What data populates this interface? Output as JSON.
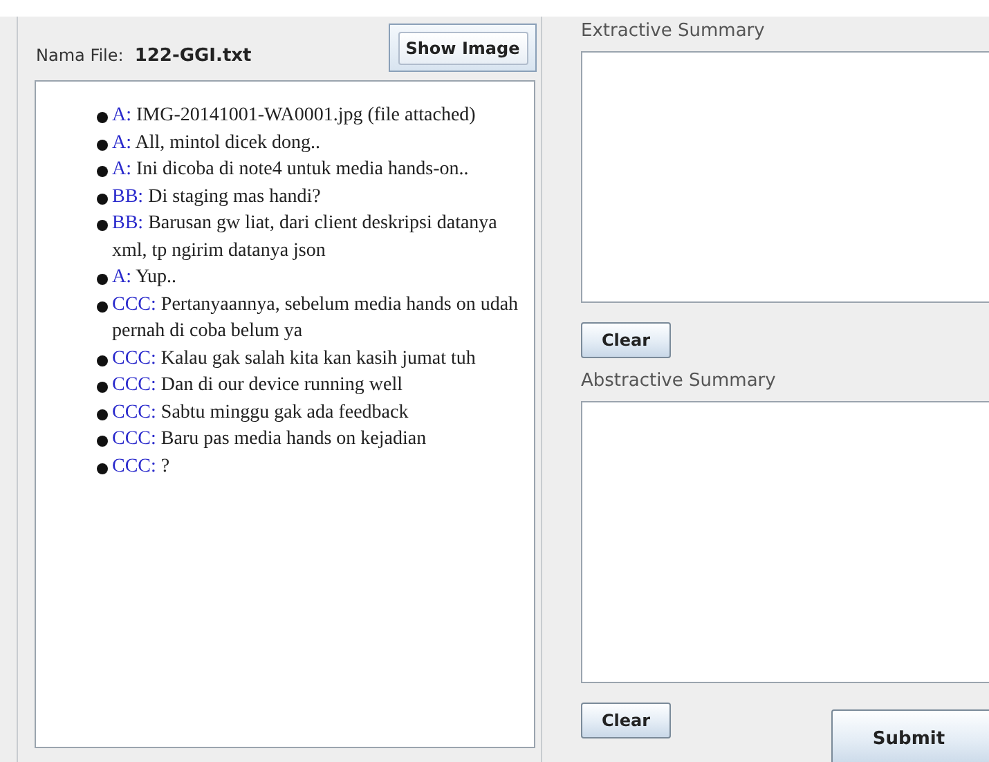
{
  "file_panel": {
    "label": "Nama File:",
    "file_name": "122-GGI.txt",
    "show_image_button": "Show Image"
  },
  "messages": [
    {
      "speaker": "A:",
      "text": " IMG-20141001-WA0001.jpg (file attached)"
    },
    {
      "speaker": "A:",
      "text": " All, mintol dicek dong.."
    },
    {
      "speaker": "A:",
      "text": " Ini dicoba di note4 untuk media hands-on.."
    },
    {
      "speaker": "BB:",
      "text": " Di staging mas handi?"
    },
    {
      "speaker": "BB:",
      "text": " Barusan gw liat, dari client deskripsi datanya xml, tp ngirim datanya json"
    },
    {
      "speaker": "A:",
      "text": " Yup.."
    },
    {
      "speaker": "CCC:",
      "text": " Pertanyaannya, sebelum media hands on udah pernah di coba belum ya"
    },
    {
      "speaker": "CCC:",
      "text": " Kalau gak salah kita kan kasih jumat tuh"
    },
    {
      "speaker": "CCC:",
      "text": " Dan di our device running well"
    },
    {
      "speaker": "CCC:",
      "text": " Sabtu minggu gak ada feedback"
    },
    {
      "speaker": "CCC:",
      "text": " Baru pas media hands on kejadian"
    },
    {
      "speaker": "CCC:",
      "text": " ?"
    }
  ],
  "summaries": [
    {
      "title": "Extractive Summary",
      "clear_button": "Clear"
    },
    {
      "title": "Abstractive Summary",
      "clear_button": "Clear"
    }
  ],
  "submit_button": "Submit"
}
